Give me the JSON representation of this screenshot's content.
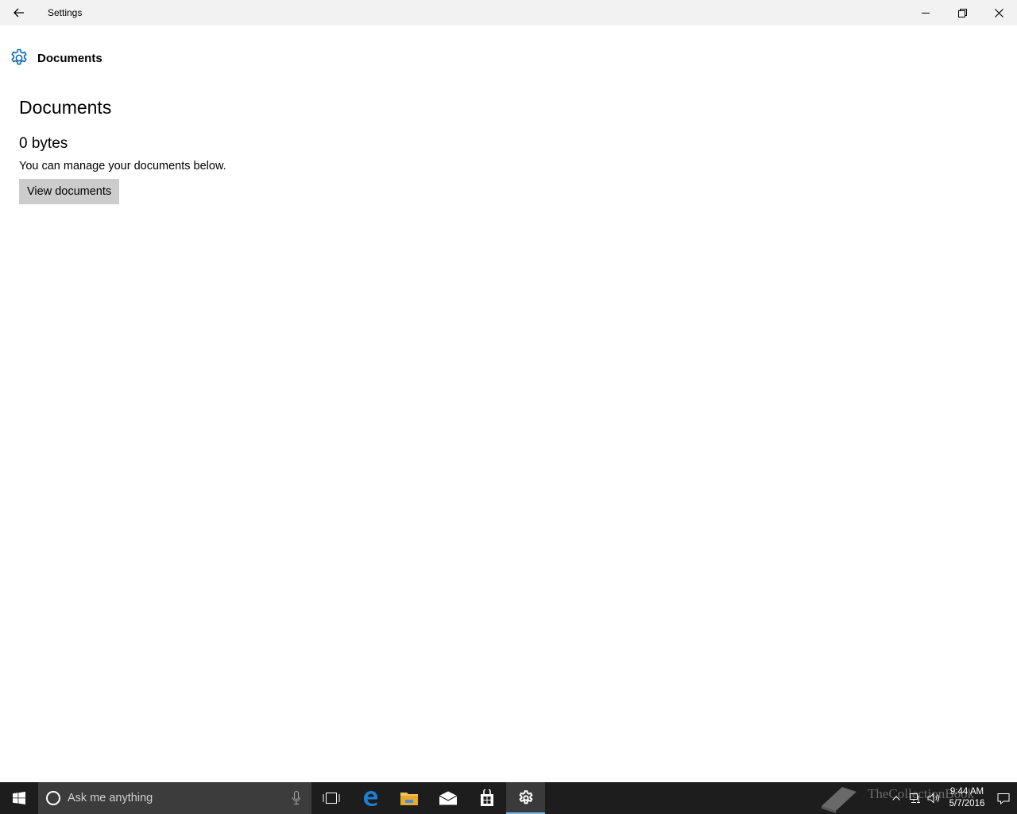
{
  "window": {
    "title": "Settings"
  },
  "header": {
    "label": "Documents"
  },
  "content": {
    "title": "Documents",
    "size": "0 bytes",
    "description": "You can manage your documents below.",
    "view_button_label": "View documents"
  },
  "taskbar": {
    "search_placeholder": "Ask me anything",
    "watermark": "TheCollectionBook",
    "time": "9:44 AM",
    "date": "5/7/2016"
  },
  "colors": {
    "accent": "#0063b1",
    "titlebar": "#f2f2f2",
    "button": "#cccccc",
    "taskbar": "#1d1d1d",
    "taskbar_active_indicator": "#76b9ed"
  }
}
